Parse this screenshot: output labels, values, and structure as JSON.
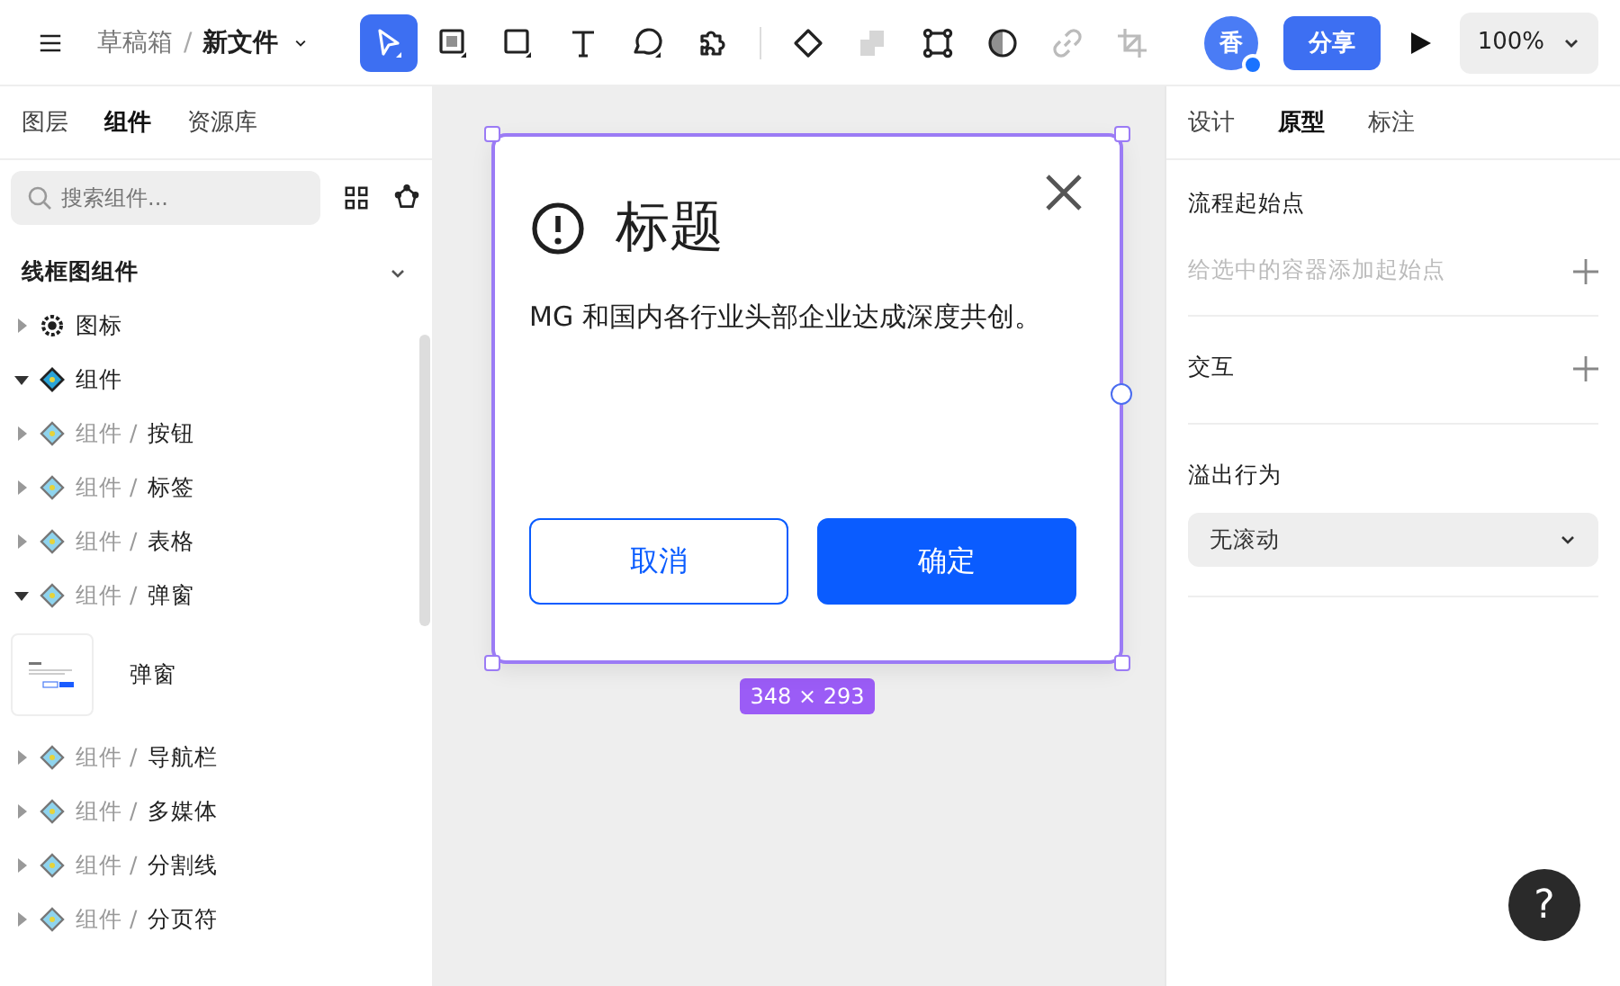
{
  "topbar": {
    "breadcrumb": {
      "folder": "草稿箱",
      "separator": "/",
      "file": "新文件"
    },
    "tools": [
      {
        "kind": "pointer",
        "selected": true
      },
      {
        "kind": "frame",
        "selected": false
      },
      {
        "kind": "rect",
        "selected": false
      },
      {
        "kind": "text",
        "selected": false
      },
      {
        "kind": "bubble",
        "selected": false
      },
      {
        "kind": "puzzle",
        "selected": false
      }
    ],
    "actions": [
      {
        "kind": "diamond",
        "disabled": false
      },
      {
        "kind": "boolean",
        "disabled": true
      },
      {
        "kind": "outline",
        "disabled": false
      },
      {
        "kind": "mask",
        "disabled": false
      },
      {
        "kind": "link",
        "disabled": true
      },
      {
        "kind": "crop",
        "disabled": true
      }
    ],
    "avatar": "香",
    "share": "分享",
    "zoom": "100%"
  },
  "left_panel": {
    "tabs": [
      {
        "label": "图层",
        "selected": false
      },
      {
        "label": "组件",
        "selected": true
      },
      {
        "label": "资源库",
        "selected": false
      }
    ],
    "search": {
      "placeholder": "搜索组件..."
    },
    "section": {
      "title": "线框图组件",
      "expanded": true
    },
    "items": [
      {
        "kind": "gear",
        "name": "图标",
        "expanded": false
      },
      {
        "kind": "main",
        "name": "组件",
        "expanded": true
      },
      {
        "kind": "sub",
        "path": "组件 /",
        "name": "按钮",
        "expanded": false
      },
      {
        "kind": "sub",
        "path": "组件 /",
        "name": "标签",
        "expanded": false
      },
      {
        "kind": "sub",
        "path": "组件 /",
        "name": "表格",
        "expanded": false
      },
      {
        "kind": "sub",
        "path": "组件 /",
        "name": "弹窗",
        "expanded": true,
        "children": [
          {
            "name": "弹窗"
          }
        ]
      },
      {
        "kind": "sub",
        "path": "组件 /",
        "name": "导航栏",
        "expanded": false
      },
      {
        "kind": "sub",
        "path": "组件 /",
        "name": "多媒体",
        "expanded": false
      },
      {
        "kind": "sub",
        "path": "组件 /",
        "name": "分割线",
        "expanded": false
      },
      {
        "kind": "sub",
        "path": "组件 /",
        "name": "分页符",
        "expanded": false
      }
    ]
  },
  "canvas": {
    "dialog": {
      "title": "标题",
      "body": "MG 和国内各行业头部企业达成深度共创。",
      "buttons": [
        {
          "label": "取消",
          "kind": "secondary"
        },
        {
          "label": "确定",
          "kind": "primary"
        }
      ]
    },
    "size_label": "348 × 293"
  },
  "right_panel": {
    "tabs": [
      {
        "label": "设计",
        "selected": false
      },
      {
        "label": "原型",
        "selected": true
      },
      {
        "label": "标注",
        "selected": false
      }
    ],
    "flow_start": {
      "title": "流程起始点",
      "hint": "给选中的容器添加起始点"
    },
    "interaction": {
      "title": "交互"
    },
    "overflow": {
      "title": "溢出行为",
      "value": "无滚动"
    }
  },
  "help": "?"
}
